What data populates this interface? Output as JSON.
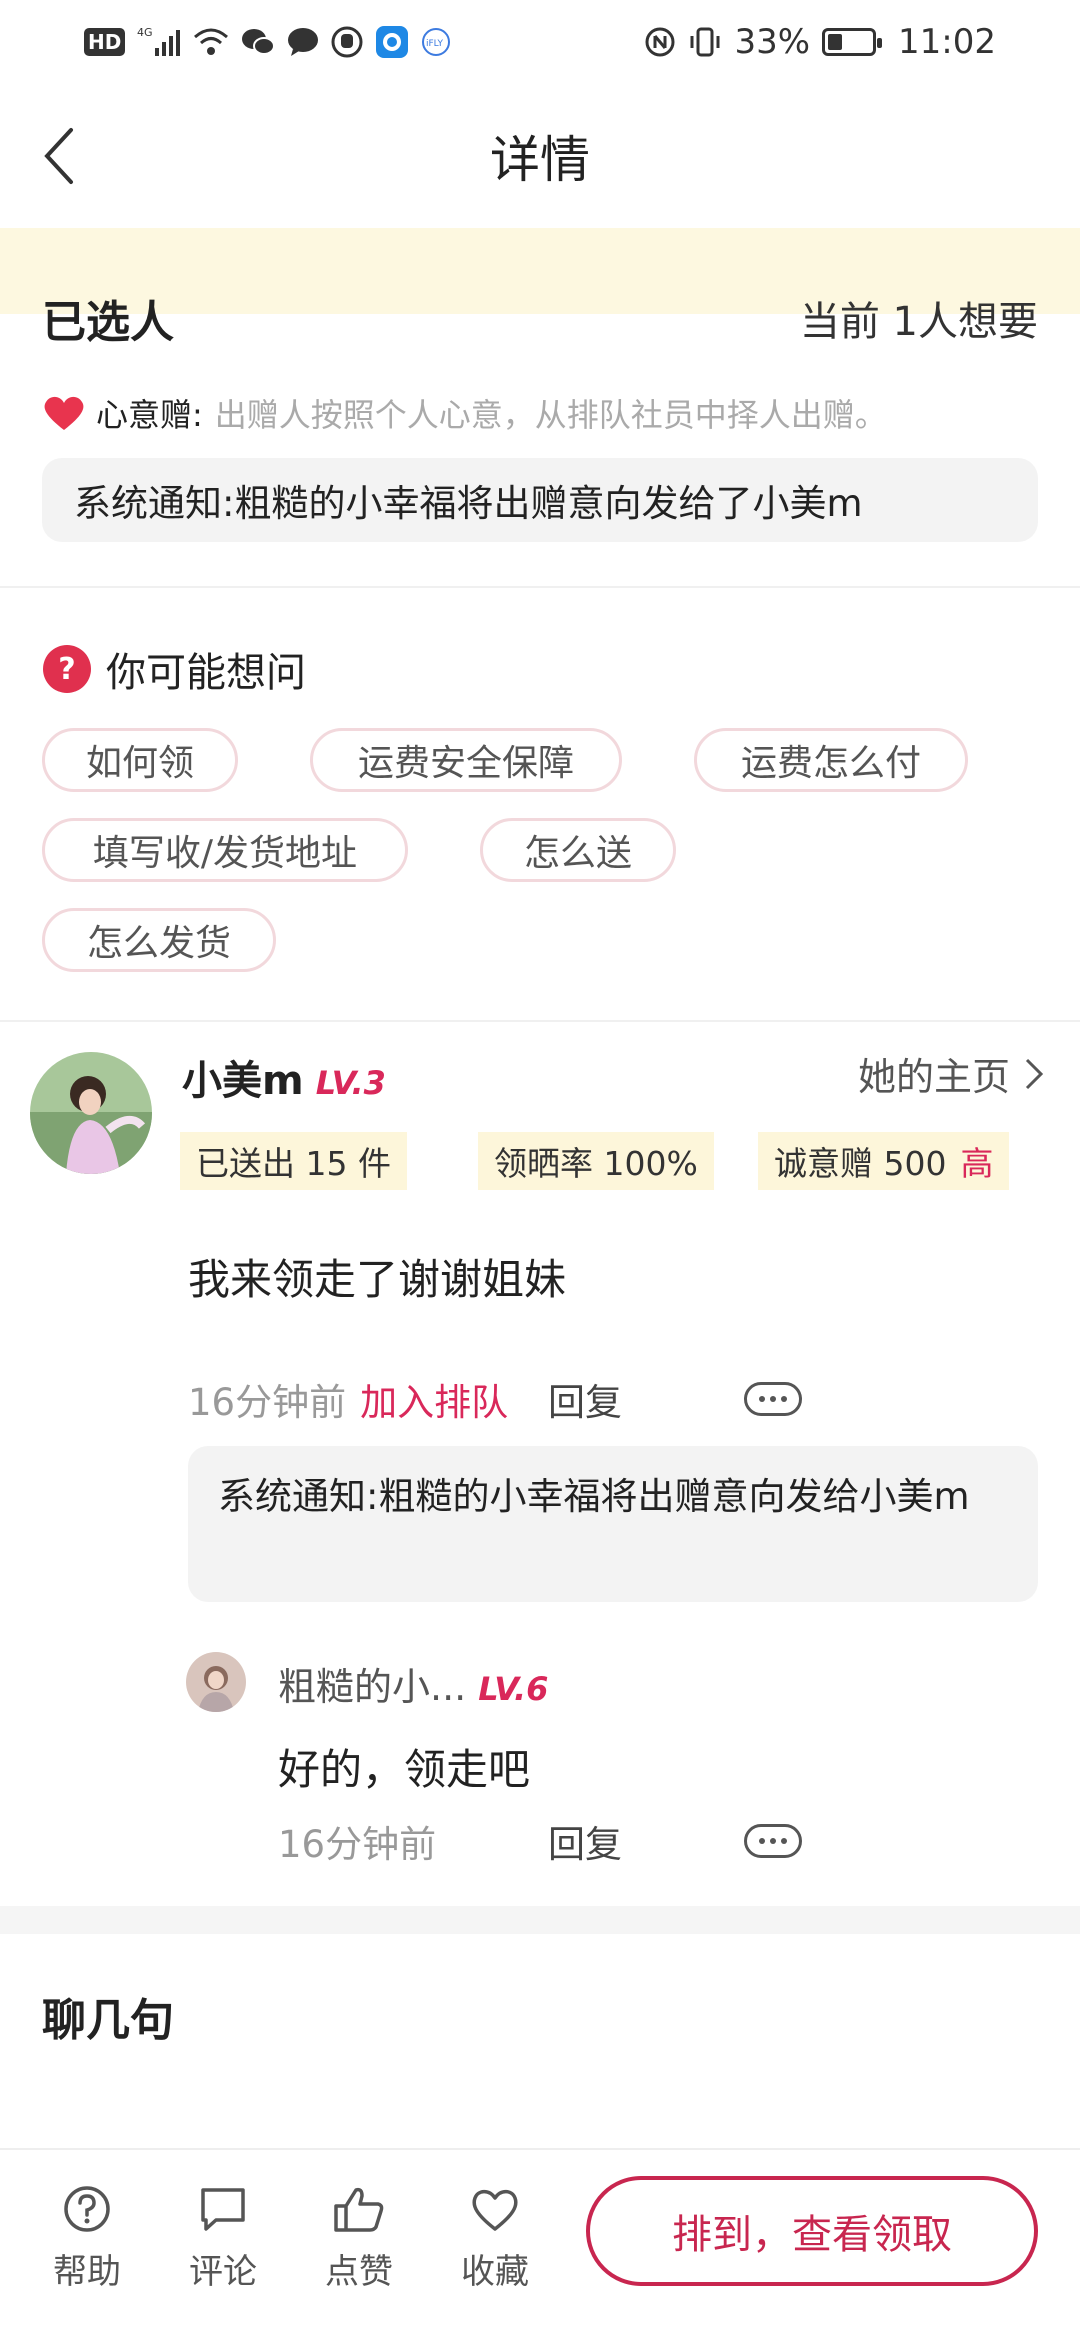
{
  "status_bar": {
    "signal_label": "4G",
    "hd_label": "HD",
    "ifly_label": "iFLY",
    "battery": "33%",
    "battery_level": 0.33,
    "time": "11:02"
  },
  "header": {
    "title": "详情"
  },
  "selected": {
    "title": "已选人",
    "want_count": "当前 1人想要",
    "heart_label": "心意赠:",
    "heart_desc": "出赠人按照个人心意，从排队社员中择人出赠。",
    "system_notice": "系统通知:粗糙的小幸福将出赠意向发给了小美m"
  },
  "faq": {
    "title": "你可能想问",
    "tags": [
      "如何领",
      "运费安全保障",
      "运费怎么付",
      "填写收/发货地址",
      "怎么送",
      "怎么发货"
    ]
  },
  "user_comment": {
    "name": "小美m",
    "level": "LV.3",
    "homepage_label": "她的主页",
    "stats": {
      "sent": "已送出 15 件",
      "claim_rate": "领晒率 100%",
      "sincerity": "诚意赠 500",
      "sincerity_level": "高"
    },
    "text": "我来领走了谢谢姐妹",
    "time": "16分钟前",
    "join_label": "加入排队",
    "reply_label": "回复",
    "system_reply": "系统通知:粗糙的小幸福将出赠意向发给小美m"
  },
  "sub_reply": {
    "name": "粗糙的小...",
    "level": "LV.6",
    "text": "好的，领走吧",
    "time": "16分钟前",
    "reply_label": "回复"
  },
  "chat_section": {
    "title": "聊几句"
  },
  "bottom_bar": {
    "help": "帮助",
    "comment": "评论",
    "like": "点赞",
    "favorite": "收藏",
    "cta": "排到，查看领取"
  },
  "colors": {
    "accent": "#d9285a",
    "cta_border": "#c8264f",
    "stat_bg": "#fdf6da",
    "notice_band": "#fdf8e0",
    "tag_border": "#f2d8dc"
  }
}
